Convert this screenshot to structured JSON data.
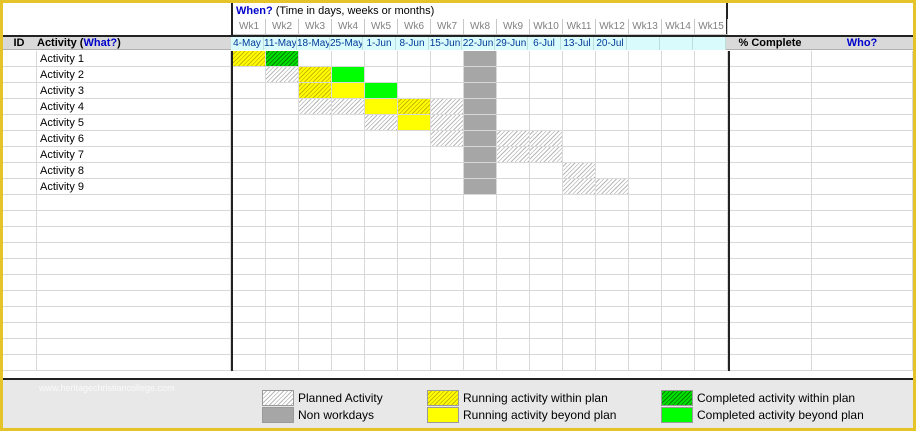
{
  "header": {
    "when_prefix": "When?",
    "when_rest": " (Time in days, weeks or months)"
  },
  "columns": {
    "id": "ID",
    "activity_prefix": "Activity (",
    "activity_what": "What?",
    "activity_suffix": ")",
    "complete": "% Complete",
    "who": "Who?"
  },
  "weeks": [
    "Wk1",
    "Wk2",
    "Wk3",
    "Wk4",
    "Wk5",
    "Wk6",
    "Wk7",
    "Wk8",
    "Wk9",
    "Wk10",
    "Wk11",
    "Wk12",
    "Wk13",
    "Wk14",
    "Wk15"
  ],
  "dates": [
    "4-May",
    "11-May",
    "18-May",
    "25-May",
    "1-Jun",
    "8-Jun",
    "15-Jun",
    "22-Jun",
    "29-Jun",
    "6-Jul",
    "13-Jul",
    "20-Jul",
    "",
    "",
    ""
  ],
  "activities": [
    {
      "name": "Activity 1",
      "cells": {
        "1": "running-within",
        "2": "completed-within"
      }
    },
    {
      "name": "Activity 2",
      "cells": {
        "2": "planned",
        "3": "running-within",
        "4": "completed-beyond"
      }
    },
    {
      "name": "Activity 3",
      "cells": {
        "3": "running-within",
        "4": "running-beyond",
        "5": "completed-beyond"
      }
    },
    {
      "name": "Activity 4",
      "cells": {
        "3": "planned",
        "4": "planned",
        "5": "running-beyond",
        "6": "running-within",
        "7": "planned"
      }
    },
    {
      "name": "Activity 5",
      "cells": {
        "5": "planned",
        "6": "running-beyond",
        "7": "planned"
      }
    },
    {
      "name": "Activity 6",
      "cells": {
        "7": "planned",
        "9": "planned",
        "10": "planned"
      }
    },
    {
      "name": "Activity 7",
      "cells": {
        "9": "planned",
        "10": "planned"
      }
    },
    {
      "name": "Activity 8",
      "cells": {
        "11": "planned"
      }
    },
    {
      "name": "Activity 9",
      "cells": {
        "11": "planned",
        "12": "planned"
      }
    }
  ],
  "non_workday_week": 8,
  "legend": [
    {
      "label": "Planned Activity",
      "style": "planned"
    },
    {
      "label": "Non workdays",
      "style": "nonwork"
    },
    {
      "label": "Running activity within plan",
      "style": "running-within"
    },
    {
      "label": "Running activity beyond plan",
      "style": "running-beyond"
    },
    {
      "label": "Completed activity within plan",
      "style": "completed-within"
    },
    {
      "label": "Completed activity beyond plan",
      "style": "completed-beyond"
    }
  ],
  "watermark": "www.heritagechristiancollege.com",
  "colors": {
    "frame": "#e4c428",
    "date_row": "#d9fbfb",
    "date_text": "#003a99",
    "question_text": "#0000cc",
    "nonwork": "#a6a6a6",
    "running_beyond": "#ffff00",
    "completed_beyond": "#00ff00"
  }
}
